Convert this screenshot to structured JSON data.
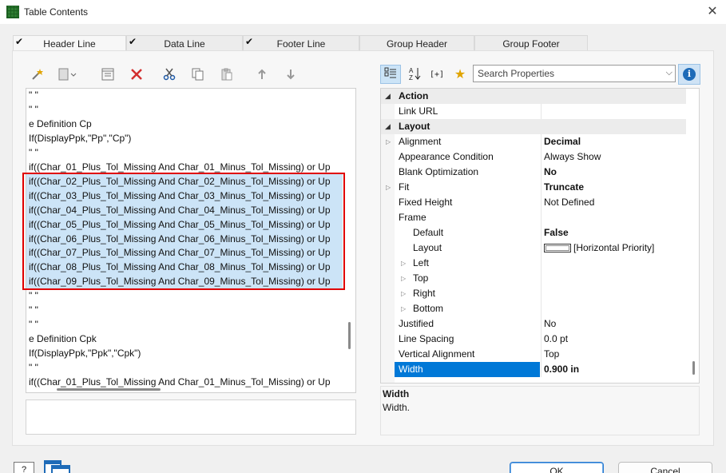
{
  "window": {
    "title": "Table Contents"
  },
  "tabs": [
    {
      "label": "Header Line",
      "checked": true,
      "active": true
    },
    {
      "label": "Data Line",
      "checked": true,
      "active": false
    },
    {
      "label": "Footer Line",
      "checked": true,
      "active": false
    },
    {
      "label": "Group Header",
      "checked": false,
      "active": false
    },
    {
      "label": "Group Footer",
      "checked": false,
      "active": false
    }
  ],
  "left_toolbar": [
    "magic-wand-icon",
    "new-item-icon",
    "properties-icon",
    "delete-icon",
    "cut-icon",
    "copy-icon",
    "paste-icon",
    "move-up-icon",
    "move-down-icon"
  ],
  "left_list": {
    "rows": [
      {
        "text": "\" \"",
        "selected": false
      },
      {
        "text": "\" \"",
        "selected": false
      },
      {
        "text": "e Definition Cp",
        "selected": false
      },
      {
        "text": "If(DisplayPpk,\"Pp\",\"Cp\")",
        "selected": false
      },
      {
        "text": "\" \"",
        "selected": false
      },
      {
        "text": "if((Char_01_Plus_Tol_Missing And Char_01_Minus_Tol_Missing) or Up",
        "selected": false
      },
      {
        "text": "if((Char_02_Plus_Tol_Missing And Char_02_Minus_Tol_Missing) or Up",
        "selected": true
      },
      {
        "text": "if((Char_03_Plus_Tol_Missing And Char_03_Minus_Tol_Missing) or Up",
        "selected": true
      },
      {
        "text": "if((Char_04_Plus_Tol_Missing And Char_04_Minus_Tol_Missing) or Up",
        "selected": true
      },
      {
        "text": "if((Char_05_Plus_Tol_Missing And Char_05_Minus_Tol_Missing) or Up",
        "selected": true
      },
      {
        "text": "if((Char_06_Plus_Tol_Missing And Char_06_Minus_Tol_Missing) or Up",
        "selected": true
      },
      {
        "text": "if((Char_07_Plus_Tol_Missing And Char_07_Minus_Tol_Missing) or Up",
        "selected": true
      },
      {
        "text": "if((Char_08_Plus_Tol_Missing And Char_08_Minus_Tol_Missing) or Up",
        "selected": true
      },
      {
        "text": "if((Char_09_Plus_Tol_Missing And Char_09_Minus_Tol_Missing) or Up",
        "selected": true
      },
      {
        "text": "\" \"",
        "selected": false
      },
      {
        "text": "\" \"",
        "selected": false
      },
      {
        "text": "\" \"",
        "selected": false
      },
      {
        "text": "e Definition Cpk",
        "selected": false
      },
      {
        "text": "If(DisplayPpk,\"Ppk\",\"Cpk\")",
        "selected": false
      },
      {
        "text": "\" \"",
        "selected": false
      },
      {
        "text": "if((Char_01_Plus_Tol_Missing And Char_01_Minus_Tol_Missing) or Up",
        "selected": false
      }
    ]
  },
  "right_toolbar": {
    "buttons": [
      "categorized-icon",
      "sort-az-icon",
      "expand-icon",
      "favorites-icon"
    ],
    "search_placeholder": "Search Properties",
    "info_glyph": "i"
  },
  "properties": [
    {
      "type": "cat",
      "name": "Action",
      "value": ""
    },
    {
      "type": "prop",
      "name": "Link URL",
      "value": "",
      "level": 0
    },
    {
      "type": "cat",
      "name": "Layout",
      "value": ""
    },
    {
      "type": "prop",
      "name": "Alignment",
      "value": "Decimal",
      "bold": true,
      "expander": true,
      "level": 0
    },
    {
      "type": "prop",
      "name": "Appearance Condition",
      "value": "Always Show",
      "level": 0
    },
    {
      "type": "prop",
      "name": "Blank Optimization",
      "value": "No",
      "bold": true,
      "level": 0
    },
    {
      "type": "prop",
      "name": "Fit",
      "value": "Truncate",
      "bold": true,
      "expander": true,
      "level": 0
    },
    {
      "type": "prop",
      "name": "Fixed Height",
      "value": "Not Defined",
      "level": 0
    },
    {
      "type": "prop",
      "name": "Frame",
      "value": "",
      "level": 0
    },
    {
      "type": "prop",
      "name": "Default",
      "value": "False",
      "bold": true,
      "level": 1
    },
    {
      "type": "prop",
      "name": "Layout",
      "value": "[Horizontal Priority]",
      "swatch": true,
      "level": 1
    },
    {
      "type": "prop",
      "name": "Left",
      "value": "",
      "expander": true,
      "level": 1
    },
    {
      "type": "prop",
      "name": "Top",
      "value": "",
      "expander": true,
      "level": 1
    },
    {
      "type": "prop",
      "name": "Right",
      "value": "",
      "expander": true,
      "level": 1
    },
    {
      "type": "prop",
      "name": "Bottom",
      "value": "",
      "expander": true,
      "level": 1
    },
    {
      "type": "prop",
      "name": "Justified",
      "value": "No",
      "level": 0
    },
    {
      "type": "prop",
      "name": "Line Spacing",
      "value": "0.0 pt",
      "level": 0
    },
    {
      "type": "prop",
      "name": "Vertical Alignment",
      "value": "Top",
      "level": 0
    },
    {
      "type": "prop",
      "name": "Width",
      "value": "0.900 in",
      "bold": true,
      "highlighted": true,
      "level": 0
    }
  ],
  "help": {
    "title": "Width",
    "text": "Width."
  },
  "bottom": {
    "help_label": "?",
    "ok_label": "OK",
    "cancel_label": "Cancel"
  }
}
